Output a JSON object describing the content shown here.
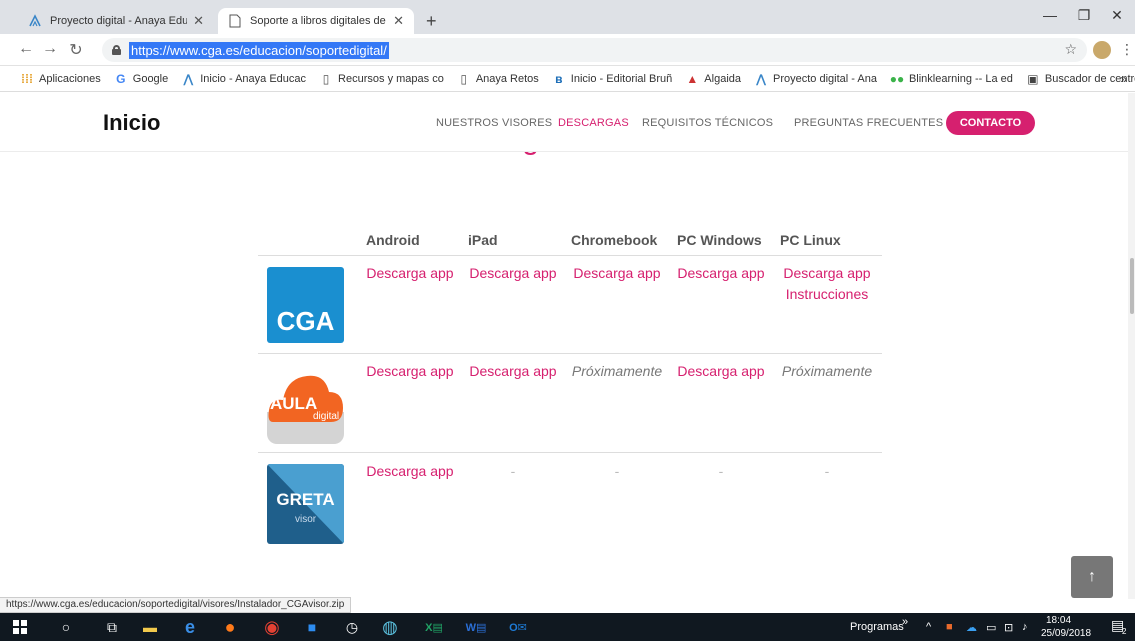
{
  "browser": {
    "tabs": [
      {
        "title": "Proyecto digital - Anaya Educació",
        "active": false
      },
      {
        "title": "Soporte a libros digitales de Grup",
        "active": true
      }
    ],
    "new_tab": "+",
    "url": "https://www.cga.es/educacion/soportedigital/",
    "bookmarks": [
      {
        "label": "Aplicaciones",
        "icon": "apps-grid-icon"
      },
      {
        "label": "Google",
        "icon": "google-icon"
      },
      {
        "label": "Inicio - Anaya Educac",
        "icon": "anaya-icon"
      },
      {
        "label": "Recursos y mapas co",
        "icon": "page-icon"
      },
      {
        "label": "Anaya Retos",
        "icon": "page-icon"
      },
      {
        "label": "Inicio - Editorial Bruñ",
        "icon": "bruno-icon"
      },
      {
        "label": "Algaida",
        "icon": "algaida-icon"
      },
      {
        "label": "Proyecto digital - Ana",
        "icon": "anaya-icon"
      },
      {
        "label": "Blinklearning -- La ed",
        "icon": "blink-icon"
      },
      {
        "label": "Buscador de centros",
        "icon": "school-icon"
      }
    ],
    "more_bookmarks": "»",
    "status_url": "https://www.cga.es/educacion/soportedigital/visores/Instalador_CGAvisor.zip"
  },
  "site": {
    "brand": "Inicio",
    "nav": [
      {
        "label": "NUESTROS VISORES",
        "active": false
      },
      {
        "label": "DESCARGAS",
        "active": true
      },
      {
        "label": "REQUISITOS TÉCNICOS",
        "active": false
      },
      {
        "label": "PREGUNTAS FRECUENTES",
        "active": false
      }
    ],
    "contact": "CONTACTO",
    "section_title": "Descarga de visores",
    "columns": [
      "Android",
      "iPad",
      "Chromebook",
      "PC Windows",
      "PC Linux"
    ],
    "rows": [
      {
        "logo": {
          "text": "CGA",
          "sub": ""
        },
        "cells": [
          [
            "Descarga app"
          ],
          [
            "Descarga app"
          ],
          [
            "Descarga app"
          ],
          [
            "Descarga app"
          ],
          [
            "Descarga app",
            "Instrucciones"
          ]
        ]
      },
      {
        "logo": {
          "text": "AULA",
          "sub": "digital"
        },
        "cells": [
          [
            "Descarga app"
          ],
          [
            "Descarga app"
          ],
          [
            "Próximamente"
          ],
          [
            "Descarga app"
          ],
          [
            "Próximamente"
          ]
        ]
      },
      {
        "logo": {
          "text": "GRETA",
          "sub": "visor"
        },
        "cells": [
          [
            "Descarga app"
          ],
          [
            "-"
          ],
          [
            "-"
          ],
          [
            "-"
          ],
          [
            "-"
          ]
        ]
      }
    ],
    "back_to_top": "↑"
  },
  "taskbar": {
    "programs_label": "Programas",
    "time": "18:04",
    "date": "25/09/2018",
    "notification_count": "2"
  },
  "colors": {
    "accent": "#d6206f",
    "cga_blue": "#1a8fd0",
    "aula_orange": "#f26522",
    "greta_blue": "#1f5f8b"
  }
}
